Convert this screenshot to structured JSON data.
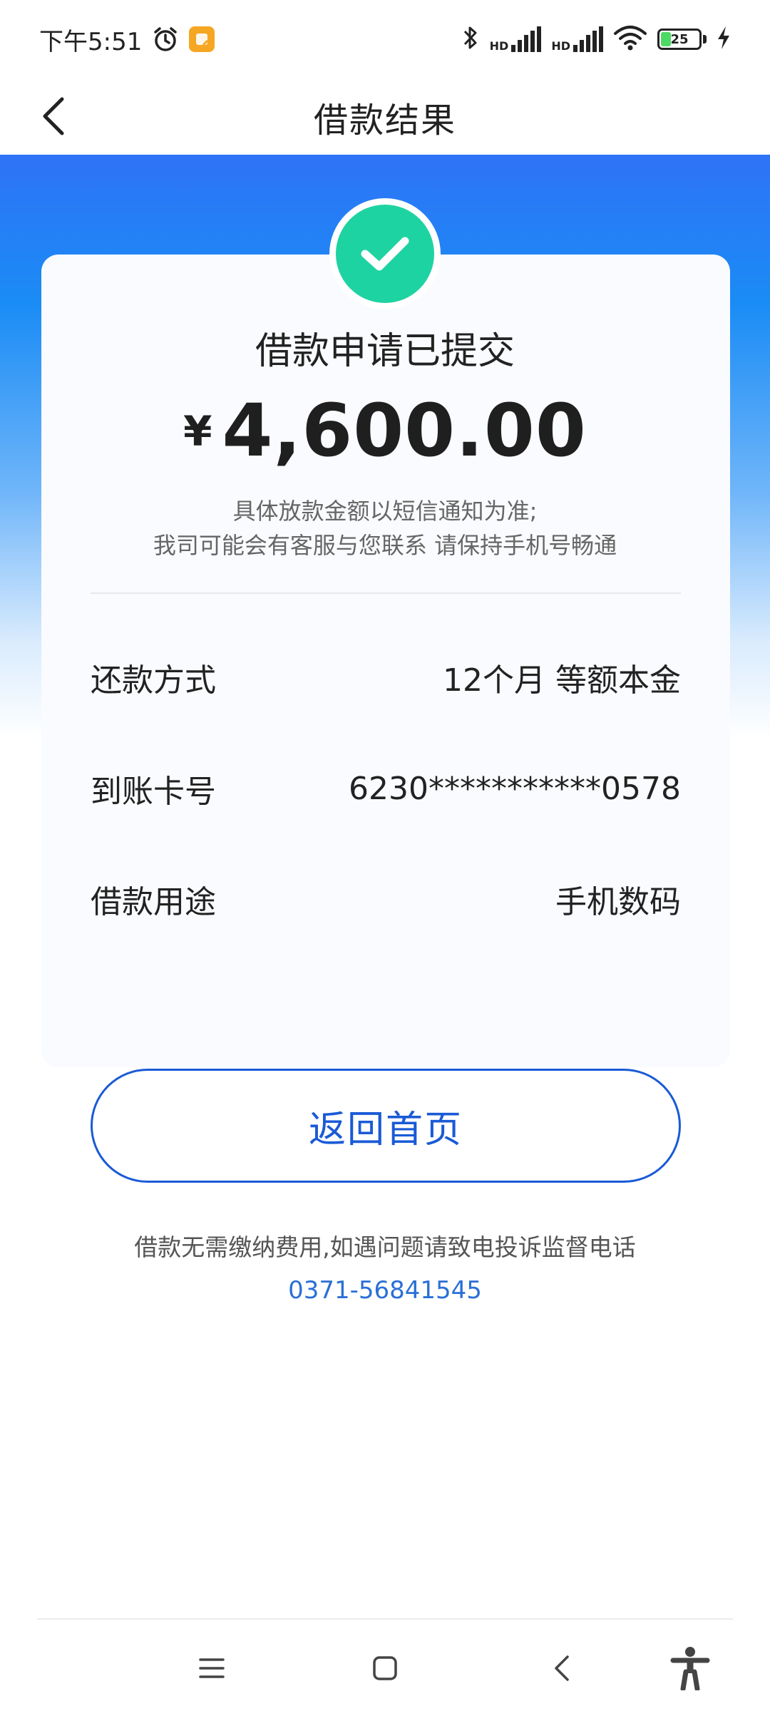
{
  "status_bar": {
    "time": "下午5:51",
    "hd1": "HD",
    "hd2": "HD",
    "battery": "25"
  },
  "header": {
    "title": "借款结果"
  },
  "result": {
    "title": "借款申请已提交",
    "currency": "¥",
    "amount": "4,600.00",
    "note1": "具体放款金额以短信通知为准;",
    "note2": "我司可能会有客服与您联系 请保持手机号畅通"
  },
  "details": [
    {
      "label": "还款方式",
      "value": "12个月 等额本金"
    },
    {
      "label": "到账卡号",
      "value": "6230***********0578"
    },
    {
      "label": "借款用途",
      "value": "手机数码"
    }
  ],
  "actions": {
    "home_label": "返回首页"
  },
  "footer": {
    "note": "借款无需缴纳费用,如遇问题请致电投诉监督电话",
    "phone": "0371-56841545"
  },
  "colors": {
    "accent": "#1a5ad6",
    "success": "#1ed3a2",
    "gradient_top": "#2f73f6"
  }
}
